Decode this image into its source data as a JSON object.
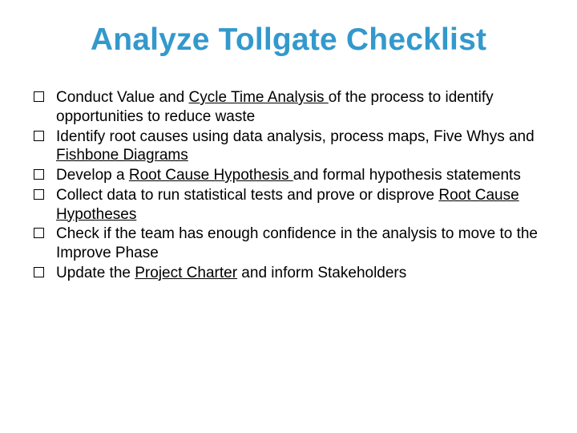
{
  "title": "Analyze Tollgate Checklist",
  "items": [
    {
      "pre": "Conduct Value and ",
      "link": "Cycle Time Analysis ",
      "post": "of the process to identify opportunities to reduce waste"
    },
    {
      "pre": "Identify root causes using data analysis, process maps, Five Whys and ",
      "link": "Fishbone Diagrams",
      "post": ""
    },
    {
      "pre": "Develop a ",
      "link": "Root Cause Hypothesis ",
      "post": "and formal hypothesis statements"
    },
    {
      "pre": "Collect data to run statistical tests and prove or disprove ",
      "link": "Root Cause Hypotheses",
      "post": ""
    },
    {
      "pre": "Check if the team has enough confidence in the analysis to move to the Improve Phase",
      "link": "",
      "post": ""
    },
    {
      "pre": "Update the ",
      "link": "Project Charter",
      "post": " and inform Stakeholders"
    }
  ]
}
